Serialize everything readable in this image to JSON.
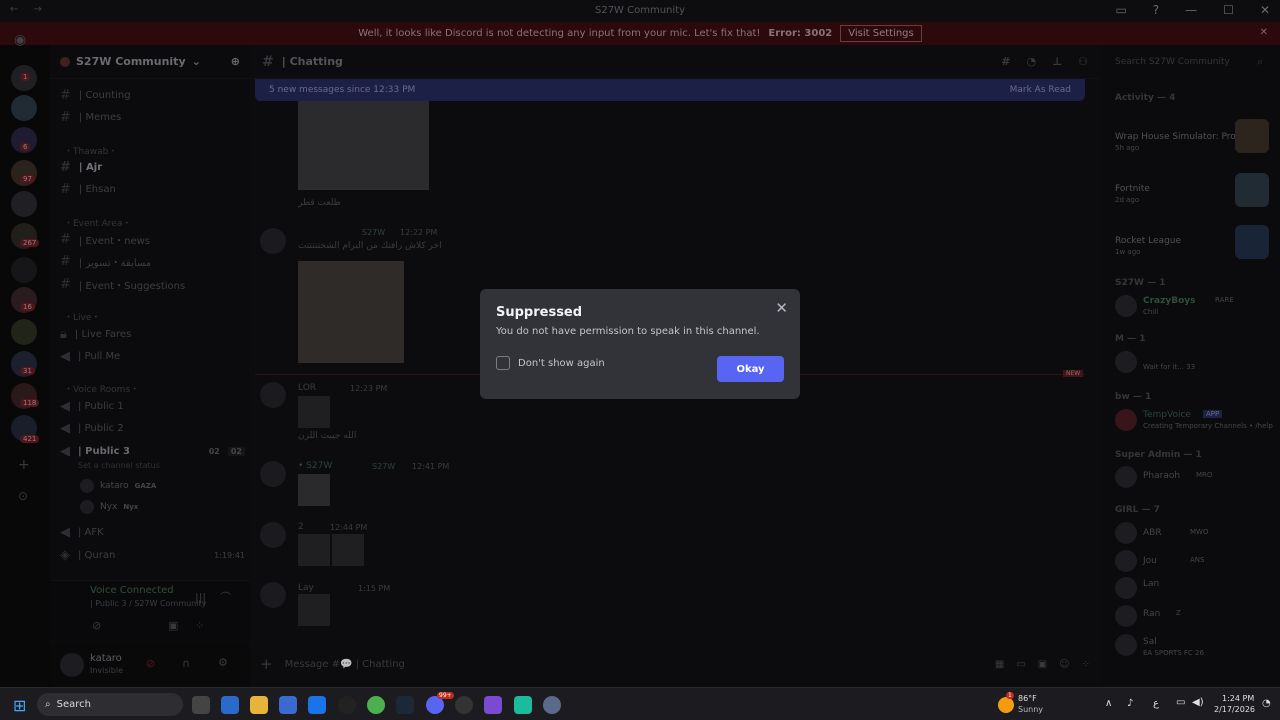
{
  "window": {
    "title": "S27W Community"
  },
  "notice": {
    "text": "Well, it looks like Discord is not detecting any input from your mic. Let's fix that!",
    "error": "Error: 3002",
    "button": "Visit Settings"
  },
  "server": {
    "name": "S27W Community"
  },
  "rail_badges": [
    "1",
    "6",
    "97",
    "267",
    "16",
    "31",
    "118",
    "421"
  ],
  "channels": {
    "top": [
      {
        "name": "| Counting"
      },
      {
        "name": "| Memes"
      }
    ],
    "cat1": "・Thawab・",
    "thawab": [
      {
        "name": "| Ajr"
      },
      {
        "name": "| Ehsan"
      }
    ],
    "cat2": "・Event Area・",
    "events": [
      {
        "name": "| Event・news"
      },
      {
        "name": "| مسابقة・تسوير"
      },
      {
        "name": "| Event・Suggestions"
      }
    ],
    "cat3": "・Live・",
    "live": [
      {
        "name": "| Live Fares"
      },
      {
        "name": "| Pull Me"
      }
    ],
    "cat4": "・Voice Rooms・",
    "voice": [
      {
        "name": "| Public 1"
      },
      {
        "name": "| Public 2"
      },
      {
        "name": "| Public 3"
      }
    ],
    "public3_counts": [
      "02",
      "02"
    ],
    "status": "Set a channel status",
    "users": [
      {
        "name": "kataro",
        "tag": "GAZA"
      },
      {
        "name": "Nyx",
        "tag": "Nyx"
      }
    ],
    "afk": "| AFK",
    "quran": "| Quran",
    "quran_time": "1:19:41"
  },
  "voice_panel": {
    "status": "Voice Connected",
    "channel": "| Public 3 / S27W Community"
  },
  "user_panel": {
    "name": "kataro",
    "status": "Invisible"
  },
  "chat": {
    "channel": "| Chatting",
    "new_messages": "5 new messages since 12:33 PM",
    "mark_read": "Mark As Read",
    "messages": [
      {
        "text": "طلعت قطر"
      },
      {
        "tag": "S27W",
        "time": "12:22 PM",
        "text": "اخر كلاش رافتك من البرام الشختتتتتت"
      },
      {
        "author": "LOR",
        "time": "12:23 PM",
        "text": "الله جيبت اللزن"
      },
      {
        "author": "• S27W",
        "tag": "S27W",
        "time": "12:41 PM"
      },
      {
        "author": "2",
        "time": "12:44 PM"
      },
      {
        "author": "Lay",
        "time": "1:15 PM"
      }
    ],
    "new_label": "NEW",
    "compose_placeholder": "Message #💬 | Chatting"
  },
  "members": {
    "search": "Search S27W Community",
    "activity_header": "Activity — 4",
    "activities": [
      {
        "title": "Wrap House Simulator: Pro...",
        "ago": "5h ago"
      },
      {
        "title": "Fortnite",
        "ago": "2d ago"
      },
      {
        "title": "Rocket League",
        "ago": "1w ago"
      }
    ],
    "s27w_header": "S27W — 1",
    "s27w_member": {
      "name": "CrazyBoys",
      "tag": "RARE",
      "sub": "Chill"
    },
    "m_header": "M — 1",
    "m_member": "Wait for it... 33",
    "bw_header": "bw — 1",
    "bot": {
      "name": "TempVoice",
      "tag": "APP",
      "sub": "Creating Temporary Channels • /help"
    },
    "admin_header": "Super Admin — 1",
    "admin": {
      "name": "Pharaoh",
      "tag": "MRO"
    },
    "girl_header": "GIRL — 7",
    "girls": [
      {
        "name": "ABR",
        "tag": "MWO"
      },
      {
        "name": "Jou",
        "tag": "ANS"
      },
      {
        "name": "Lan"
      },
      {
        "name": "Ran",
        "tag": "Z"
      },
      {
        "name": "Sal",
        "sub": "EA SPORTS FC 26"
      }
    ]
  },
  "modal": {
    "title": "Suppressed",
    "body": "You do not have permission to speak in this channel.",
    "checkbox": "Don't show again",
    "button": "Okay"
  },
  "taskbar": {
    "search": "Search",
    "weather_temp": "86°F",
    "weather_desc": "Sunny",
    "notif": "1",
    "lang": "ع",
    "time": "1:24 PM",
    "date": "2/17/2026",
    "discord_badge": "99+"
  }
}
